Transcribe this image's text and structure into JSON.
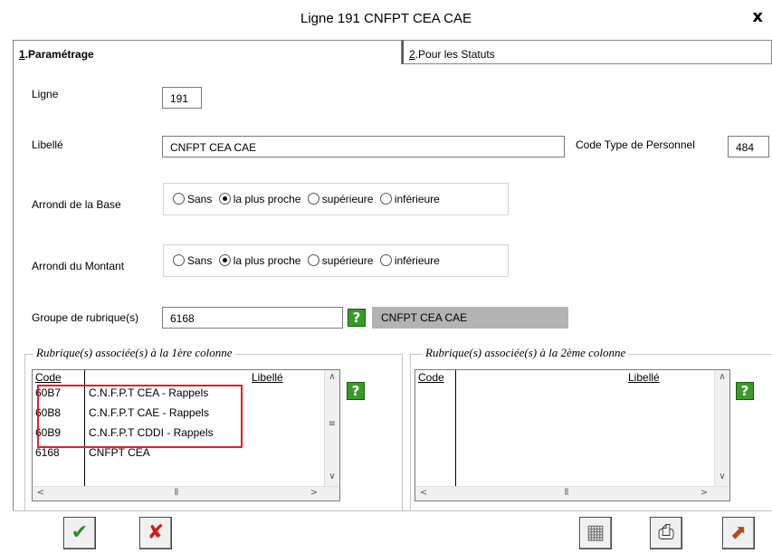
{
  "window": {
    "title": "Ligne 191 CNFPT CEA CAE",
    "close_glyph": "x"
  },
  "tabs": [
    {
      "mnemonic": "1",
      "label": ".Paramétrage",
      "active": true
    },
    {
      "mnemonic": "2",
      "label": ".Pour les Statuts",
      "active": false
    }
  ],
  "form": {
    "ligne_label": "Ligne",
    "ligne_value": "191",
    "libelle_label": "Libellé",
    "libelle_value": "CNFPT CEA CAE",
    "code_type_label": "Code Type de Personnel",
    "code_type_value": "484",
    "arrondi_base_label": "Arrondi de la Base",
    "arrondi_montant_label": "Arrondi du Montant",
    "radio_options": [
      "Sans",
      "la plus proche",
      "supérieure",
      "inférieure"
    ],
    "arrondi_base_selected": "la plus proche",
    "arrondi_montant_selected": "la plus proche",
    "groupe_label": "Groupe de rubrique(s)",
    "groupe_value": "6168",
    "groupe_libelle": "CNFPT CEA CAE"
  },
  "list1": {
    "title": "Rubrique(s) associée(s) à la 1ère colonne",
    "headers": {
      "code": "Code",
      "libelle": "Libellé"
    },
    "rows": [
      {
        "code": "60B7",
        "libelle": "C.N.F.P.T CEA - Rappels"
      },
      {
        "code": "60B8",
        "libelle": "C.N.F.P.T CAE - Rappels"
      },
      {
        "code": "60B9",
        "libelle": "C.N.F.P.T CDDI - Rappels"
      },
      {
        "code": "6168",
        "libelle": "CNFPT CEA"
      }
    ]
  },
  "list2": {
    "title": "Rubrique(s) associée(s) à la 2ème colonne",
    "headers": {
      "code": "Code",
      "libelle": "Libellé"
    }
  },
  "colors": {
    "help_green": "#3a9a2a",
    "highlight_red": "#e0202a",
    "grey_field": "#b3b3b3"
  },
  "icons": {
    "help": "?",
    "validate": "✔",
    "cancel": "✘",
    "calculator": "▦",
    "print": "⎙",
    "exit": "⬈"
  }
}
